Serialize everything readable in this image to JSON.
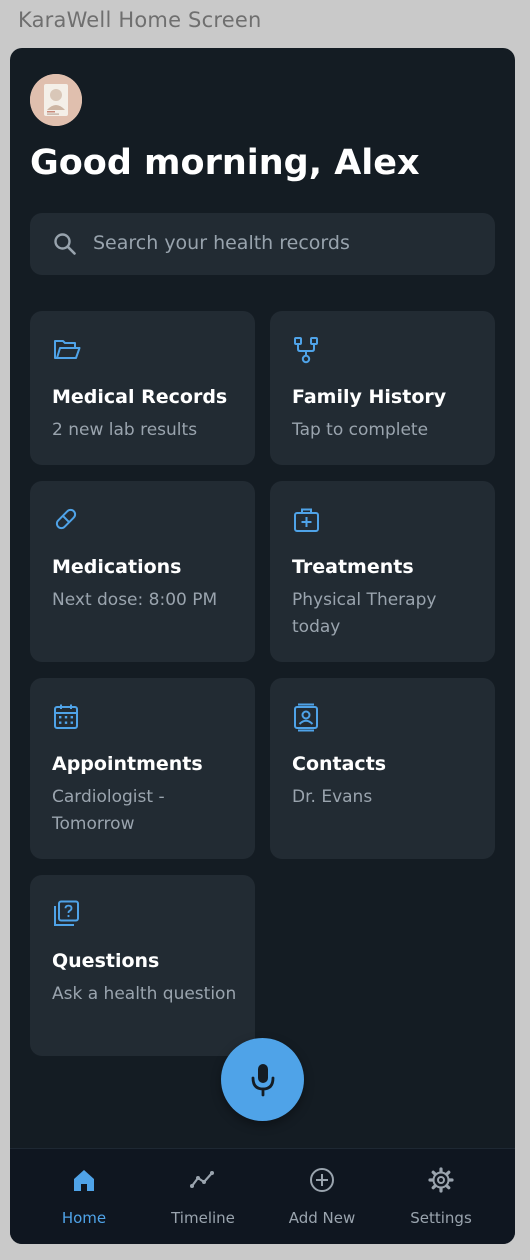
{
  "window": {
    "title": "KaraWell Home Screen"
  },
  "header": {
    "greeting": "Good morning, Alex"
  },
  "search": {
    "placeholder": "Search your health records"
  },
  "cards": [
    {
      "icon": "folder-open-icon",
      "title": "Medical Records",
      "subtitle": "2 new lab results"
    },
    {
      "icon": "family-tree-icon",
      "title": "Family History",
      "subtitle": "Tap to complete"
    },
    {
      "icon": "pill-icon",
      "title": "Medications",
      "subtitle": "Next dose: 8:00 PM"
    },
    {
      "icon": "medical-kit-icon",
      "title": "Treatments",
      "subtitle": "Physical Therapy today"
    },
    {
      "icon": "calendar-icon",
      "title": "Appointments",
      "subtitle": "Cardiologist - Tomorrow"
    },
    {
      "icon": "contact-card-icon",
      "title": "Contacts",
      "subtitle": "Dr. Evans"
    },
    {
      "icon": "question-icon",
      "title": "Questions",
      "subtitle": "Ask a health question"
    }
  ],
  "fab": {
    "icon": "microphone-icon"
  },
  "nav": {
    "items": [
      {
        "icon": "home-icon",
        "label": "Home",
        "active": true
      },
      {
        "icon": "timeline-icon",
        "label": "Timeline",
        "active": false
      },
      {
        "icon": "add-circle-icon",
        "label": "Add New",
        "active": false
      },
      {
        "icon": "gear-icon",
        "label": "Settings",
        "active": false
      }
    ]
  },
  "colors": {
    "background": "#141c23",
    "card": "#222b33",
    "accent": "#4fa3e8",
    "text_primary": "#ffffff",
    "text_secondary": "#9aa4ae"
  }
}
